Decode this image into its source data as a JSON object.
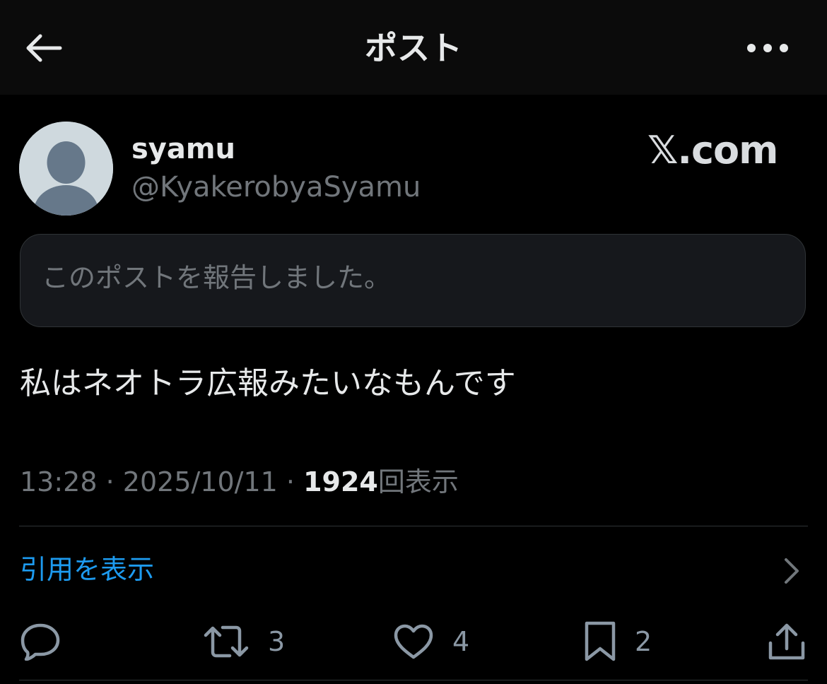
{
  "header": {
    "title": "ポスト",
    "back_icon": "arrow-left-icon",
    "more_icon": "more-horizontal-icon"
  },
  "author": {
    "display_name": "syamu",
    "handle": "@KyakerobyaSyamu",
    "avatar_icon": "default-avatar-icon"
  },
  "watermark": "𝕏.com",
  "notice": {
    "text": "このポストを報告しました。"
  },
  "post": {
    "text": "私はネオトラ広報みたいなもんです",
    "time": "13:28",
    "date": "2025/10/11",
    "views_count": "1924",
    "views_label": "回表示",
    "separator": "·"
  },
  "quotes": {
    "label": "引用を表示"
  },
  "actions": {
    "reply": {
      "icon": "reply-icon"
    },
    "repost": {
      "icon": "repost-icon",
      "count": "3"
    },
    "like": {
      "icon": "heart-icon",
      "count": "4"
    },
    "bookmark": {
      "icon": "bookmark-icon",
      "count": "2"
    },
    "share": {
      "icon": "share-icon"
    }
  },
  "colors": {
    "background": "#000000",
    "text": "#e7e9ea",
    "secondary": "#71767b",
    "accent": "#1d9bf0",
    "divider": "#2f3336"
  }
}
